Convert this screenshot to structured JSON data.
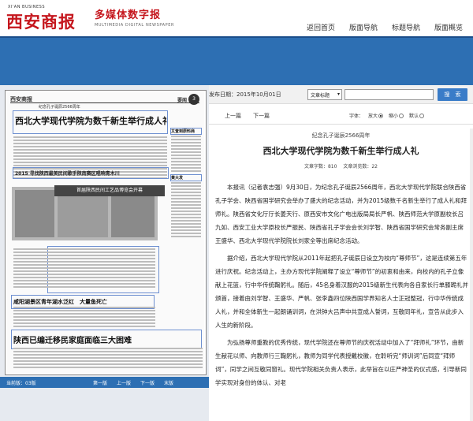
{
  "header": {
    "logo_en": "XI'AN BUSINESS",
    "logo_cn": "西安商报",
    "brand_cn": "多媒体数字报",
    "brand_en": "MULTIMEDIA DIGITAL NEWSPAPER",
    "nav": [
      "返回首页",
      "版面导航",
      "标题导航",
      "版面概览"
    ]
  },
  "paper": {
    "masthead": "西安商报",
    "kicker": "纪念孔子诞辰2566周年",
    "section_label": "要闻",
    "section_number": "3",
    "headline_main": "西北大学现代学院为数千新生举行成人礼",
    "headline_2015": "2015 寻找陕西最美民间歌手陕南赛区唱响青木川",
    "ad_text": "首届陕西民间工艺品博览会开幕",
    "headline_lake": "咸阳湖景区青年湖水泛红　大量鱼死亡",
    "headline_lower": "陕西已编迁移民家庭面临三大困难",
    "side_headlines": [
      "又查到原料商",
      "黄大发"
    ]
  },
  "pager": {
    "current": "当前版：03版",
    "first": "第一版",
    "prev": "上一版",
    "next": "下一版",
    "last": "末版"
  },
  "toolbar": {
    "date": "发布日期：2015年10月01日",
    "select_value": "文章标题",
    "search_label": "搜　索"
  },
  "article_nav": {
    "prev": "上一篇",
    "next": "下一篇",
    "font_label": "字体：",
    "font_options": [
      "放大",
      "缩小",
      "默认"
    ]
  },
  "article": {
    "subhead": "纪念孔子诞辰2566周年",
    "title": "西北大学现代学院为数千新生举行成人礼",
    "word_count": "文章字数：810",
    "view_count": "文章浏览数：22",
    "paragraphs": [
      "本报讯（记者袁志强）9月30日，为纪念孔子诞辰2566周年，西北大学现代学院联合陕西省孔子学会、陕西省国学研究会举办了盛大的纪念活动，并为2015级数千名新生举行了成人礼和拜师礼。陕西省文化厅厅长姜天行、原西安市文化广电出版局局长严帆、陕西师范大学原副校长吕九如、西安工业大学原校长严振民、陕西省孔子学会会长刘学智、陕西省国学研究会常务副主席王盛华、西北大学现代学院院长刘家全等出席纪念活动。",
      "据介绍，西北大学现代学院从2011年起把孔子诞辰日设立为校内“尊师节”，这是连续第五年进行庆祝。纪念活动上，主办方现代学院阐释了设立“尊师节”的初衷和由来，向校内的孔子立像献上花篮，行中华传统鞠躬礼。随后，45名身着汉服的2015级新生代表向各自家长行单膝跪礼并颁首，接着由刘学智、王盛华、严帆、张李鑫四位陕西国学界知名人士正冠整冠，行中华传统成人礼，并和全体新生一起朗诵训词，在洪钟大吕声中共宣成人誓词，互敬同年礼，宣告从此步入人生的新阶段。",
      "为弘扬尊师重教的优秀传统，现代学院还在尊师节的庆祝活动中加入了“拜师礼”环节，由新生献花以师、向教师行三鞠躬礼，教师为同学代表授戴校徽，在聆听完“师训词”后同宣“拜师词”，同学之间互敬同窗礼。现代学院相关负责人表示，此举旨在以庄严神圣的仪式感，引导新同学实现对身份的体认、对老"
    ]
  }
}
